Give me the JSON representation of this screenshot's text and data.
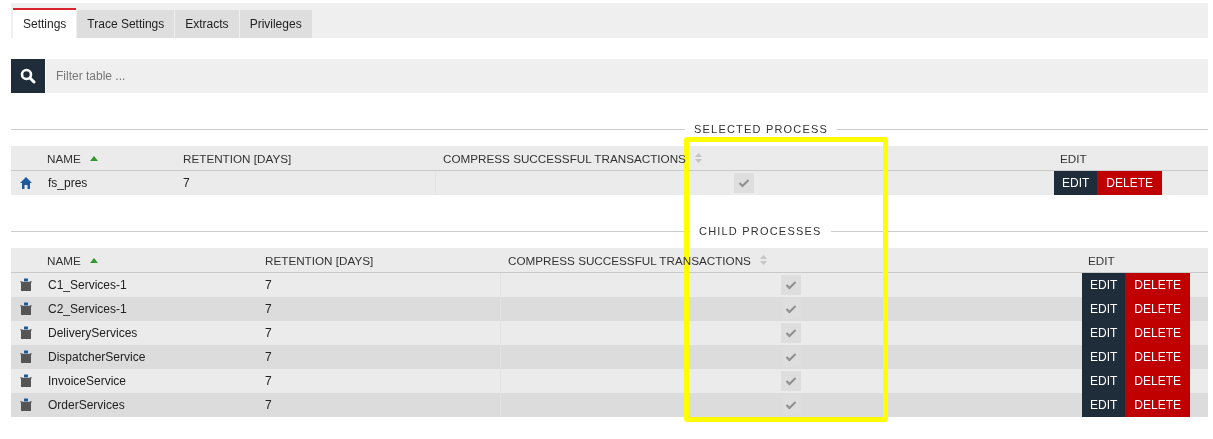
{
  "tabs": [
    {
      "label": "Settings",
      "selected": true
    },
    {
      "label": "Trace Settings",
      "selected": false
    },
    {
      "label": "Extracts",
      "selected": false
    },
    {
      "label": "Privileges",
      "selected": false
    }
  ],
  "search": {
    "placeholder": "Filter table ..."
  },
  "sections": [
    {
      "kind": "selected",
      "legend": "SELECTED PROCESS",
      "columns": [
        {
          "label": "NAME",
          "sorted": true
        },
        {
          "label": "RETENTION [DAYS]"
        },
        {
          "label": "COMPRESS SUCCESSFUL TRANSACTIONS",
          "sorted": false
        },
        {
          "label": "EDIT"
        }
      ],
      "rows": [
        {
          "name": "fs_pres",
          "retention": "7",
          "compress": true,
          "edit": "EDIT",
          "delete": "DELETE"
        }
      ]
    },
    {
      "kind": "children",
      "legend": "CHILD PROCESSES",
      "columns": [
        {
          "label": "NAME",
          "sorted": true
        },
        {
          "label": "RETENTION [DAYS]"
        },
        {
          "label": "COMPRESS SUCCESSFUL TRANSACTIONS",
          "sorted": false
        },
        {
          "label": "EDIT"
        }
      ],
      "rows": [
        {
          "name": "C1_Services-1",
          "retention": "7",
          "compress": true,
          "edit": "EDIT",
          "delete": "DELETE"
        },
        {
          "name": "C2_Services-1",
          "retention": "7",
          "compress": true,
          "edit": "EDIT",
          "delete": "DELETE"
        },
        {
          "name": "DeliveryServices",
          "retention": "7",
          "compress": true,
          "edit": "EDIT",
          "delete": "DELETE"
        },
        {
          "name": "DispatcherService",
          "retention": "7",
          "compress": true,
          "edit": "EDIT",
          "delete": "DELETE"
        },
        {
          "name": "InvoiceService",
          "retention": "7",
          "compress": true,
          "edit": "EDIT",
          "delete": "DELETE"
        },
        {
          "name": "OrderServices",
          "retention": "7",
          "compress": true,
          "edit": "EDIT",
          "delete": "DELETE"
        }
      ]
    }
  ],
  "highlight": {
    "on": true
  }
}
